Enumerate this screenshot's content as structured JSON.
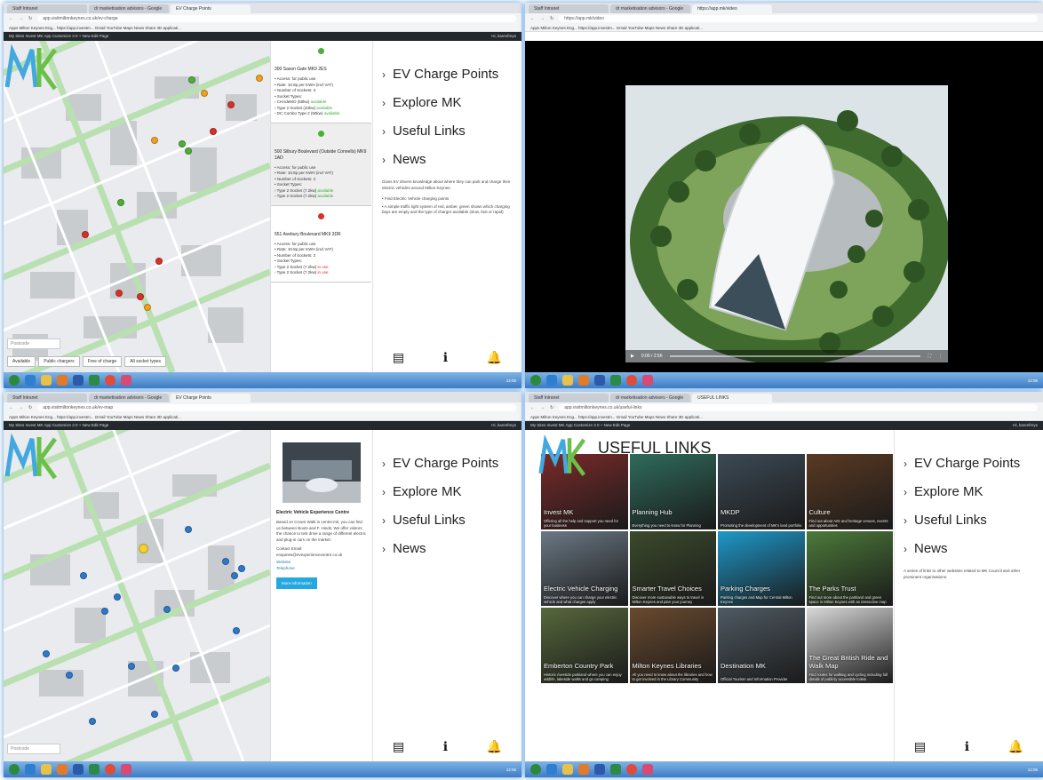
{
  "browser": {
    "tabs": [
      "Staff Intranet",
      "dr marketisation advisors - Google",
      "EV Charge Points",
      "https://app.mk/video"
    ],
    "url_p1": "app.visitmiltonkeynes.co.uk/ev-charge",
    "url_p3": "app.visitmiltonkeynes.co.uk/ev-map",
    "url_p4": "app.visitmiltonkeynes.co.uk/useful-links",
    "bookmarks": "Apps   Milton Keynes Eng...   https://app.investm...   Gmail   YouTube   Maps   News   Share 3D applicati...",
    "wp_left": "My Sites   Invest MK App   Customize   3   0   + New   Edit Page",
    "wp_right": "Hi, karenfreys",
    "clock": "12:05"
  },
  "nav": {
    "items": [
      "EV Charge Points",
      "Explore MK",
      "Useful Links",
      "News"
    ],
    "ev_desc": "Gives EV drivers knowledge about where they can park and charge their electric vehicles around Milton Keynes.",
    "ev_bullets": [
      "Find Electric Vehicle charging points",
      "A simple traffic light system of red, amber, green shows which charging bays are empty and the type of charger available (slow, fast or rapid)"
    ],
    "links_desc": "A series of links to other websites related to MK Council and other prominent organisations."
  },
  "map": {
    "postcode_placeholder": "Postcode",
    "filters": [
      "Available",
      "Public chargers",
      "Free of charge",
      "All socket types"
    ]
  },
  "stations": [
    {
      "title": "300 Saxon Gate MK9 2ES",
      "lines": [
        "• Access: for public use",
        "• Rate: 10.8p per KWH (incl VAT)",
        "• Number of Sockets: 3",
        "• Socket Types:"
      ],
      "sockets": [
        {
          "label": "› CHAdeMO (50kw)",
          "status": "available"
        },
        {
          "label": "› Type 2 Socket (43kw)",
          "status": "available"
        },
        {
          "label": "› DC Combo Type 2 (50kw)",
          "status": "available"
        }
      ]
    },
    {
      "title": "500 Silbury Boulevard (Outside Connells) MK9 1AD",
      "lines": [
        "• Access: for public use",
        "• Rate: 10.8p per KWH (incl VAT)",
        "• Number of Sockets: 2",
        "• Socket Types:"
      ],
      "sockets": [
        {
          "label": "› Type 2 Socket (7.2kw)",
          "status": "available"
        },
        {
          "label": "› Type 2 Socket (7.2kw)",
          "status": "available"
        }
      ]
    },
    {
      "title": "551 Avebury Boulevard MK9 3DR",
      "lines": [
        "• Access: for public use",
        "• Rate: 10.8p per KWH (incl VAT)",
        "• Number of Sockets: 2",
        "• Socket Types:"
      ],
      "sockets": [
        {
          "label": "› Type 2 Socket (7.2kw)",
          "status": "in use"
        },
        {
          "label": "› Type 2 Socket (7.2kw)",
          "status": "in use"
        }
      ]
    }
  ],
  "video": {
    "time": "0:00 / 2:56"
  },
  "experience": {
    "title": "Electric Vehicle Experience Centre",
    "text": "Based on Crown Walk in centre:mk, you can find us between Boots and F. Hinds. We offer visitors the chance to test drive a range of different electric and plug-in cars on the market.",
    "contact_label": "Contact Email:",
    "email": "enquiries@evexperiencecentre.co.uk",
    "website": "Website",
    "telephone": "Telephone",
    "button": "More information"
  },
  "useful_links": {
    "heading": "USEFUL LINKS",
    "tiles": [
      {
        "title": "Invest MK",
        "desc": "Offering all the help and support you need for your business",
        "color": "#7b2a2a"
      },
      {
        "title": "Planning Hub",
        "desc": "Everything you need to know for Planning",
        "color": "#2f6b5c"
      },
      {
        "title": "MKDP",
        "desc": "Promoting the development of MK's land portfolio",
        "color": "#3c4a55"
      },
      {
        "title": "Culture",
        "desc": "Find out about Arts and heritage venues, events and opportunities",
        "color": "#5a3a22"
      },
      {
        "title": "Electric Vehicle Charging",
        "desc": "Discover where you can charge your electric vehicle and what charges apply",
        "color": "#6b7884"
      },
      {
        "title": "Smarter Travel Choices",
        "desc": "Discover more sustainable ways to travel in Milton Keynes and plan your journey",
        "color": "#3b4a2c"
      },
      {
        "title": "Parking Charges",
        "desc": "Parking charges and Map for Central Milton Keynes",
        "color": "#1e98c9"
      },
      {
        "title": "The Parks Trust",
        "desc": "Find out more about the parkland and green space in Milton Keynes with an interactive map",
        "color": "#4c7a3a"
      },
      {
        "title": "Emberton Country Park",
        "desc": "Historic riverside parkland where you can enjoy wildlife, lakeside walks and go camping",
        "color": "#56683c"
      },
      {
        "title": "Milton Keynes Libraries",
        "desc": "All you need to know about the libraries and how to get involved in the Library Community",
        "color": "#6a4a2e"
      },
      {
        "title": "Destination MK",
        "desc": "Official Tourism and Information Provider",
        "color": "#4f5a63"
      },
      {
        "title": "The Great British Ride and Walk Map",
        "desc": "Find routes for walking and cycling including full details of publicly accessible toilets",
        "color": "#d8d8d8"
      }
    ]
  }
}
